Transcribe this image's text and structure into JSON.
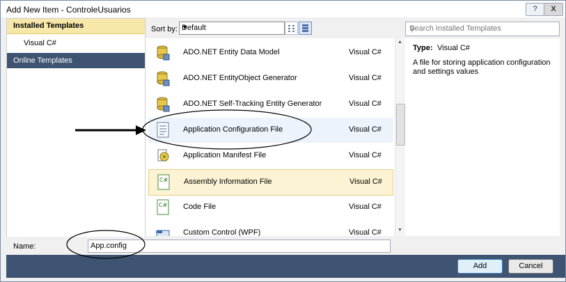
{
  "window": {
    "title": "Add New Item - ControleUsuarios",
    "help_label": "?",
    "close_label": "X"
  },
  "sidebar": {
    "header": "Installed Templates",
    "item": "Visual C#",
    "online": "Online Templates"
  },
  "sort": {
    "label": "Sort by:",
    "value": "Default"
  },
  "search": {
    "placeholder": "Search Installed Templates"
  },
  "templates": [
    {
      "name": "ADO.NET Entity Data Model",
      "lang": "Visual C#",
      "icon": "database-icon"
    },
    {
      "name": "ADO.NET EntityObject Generator",
      "lang": "Visual C#",
      "icon": "database-icon"
    },
    {
      "name": "ADO.NET Self-Tracking Entity Generator",
      "lang": "Visual C#",
      "icon": "database-icon"
    },
    {
      "name": "Application Configuration File",
      "lang": "Visual C#",
      "icon": "config-file-icon"
    },
    {
      "name": "Application Manifest File",
      "lang": "Visual C#",
      "icon": "manifest-icon"
    },
    {
      "name": "Assembly Information File",
      "lang": "Visual C#",
      "icon": "csharp-file-icon"
    },
    {
      "name": "Code File",
      "lang": "Visual C#",
      "icon": "csharp-file-icon"
    },
    {
      "name": "Custom Control (WPF)",
      "lang": "Visual C#",
      "icon": "wpf-control-icon"
    }
  ],
  "details": {
    "type_label": "Type:",
    "type_value": "Visual C#",
    "description": "A file for storing application configuration and settings values"
  },
  "name_field": {
    "label": "Name:",
    "value": "App.config"
  },
  "buttons": {
    "add": "Add",
    "cancel": "Cancel"
  },
  "colors": {
    "accent": "#3e5472",
    "selected": "#fbf3d3",
    "header": "#f7e7a8"
  }
}
